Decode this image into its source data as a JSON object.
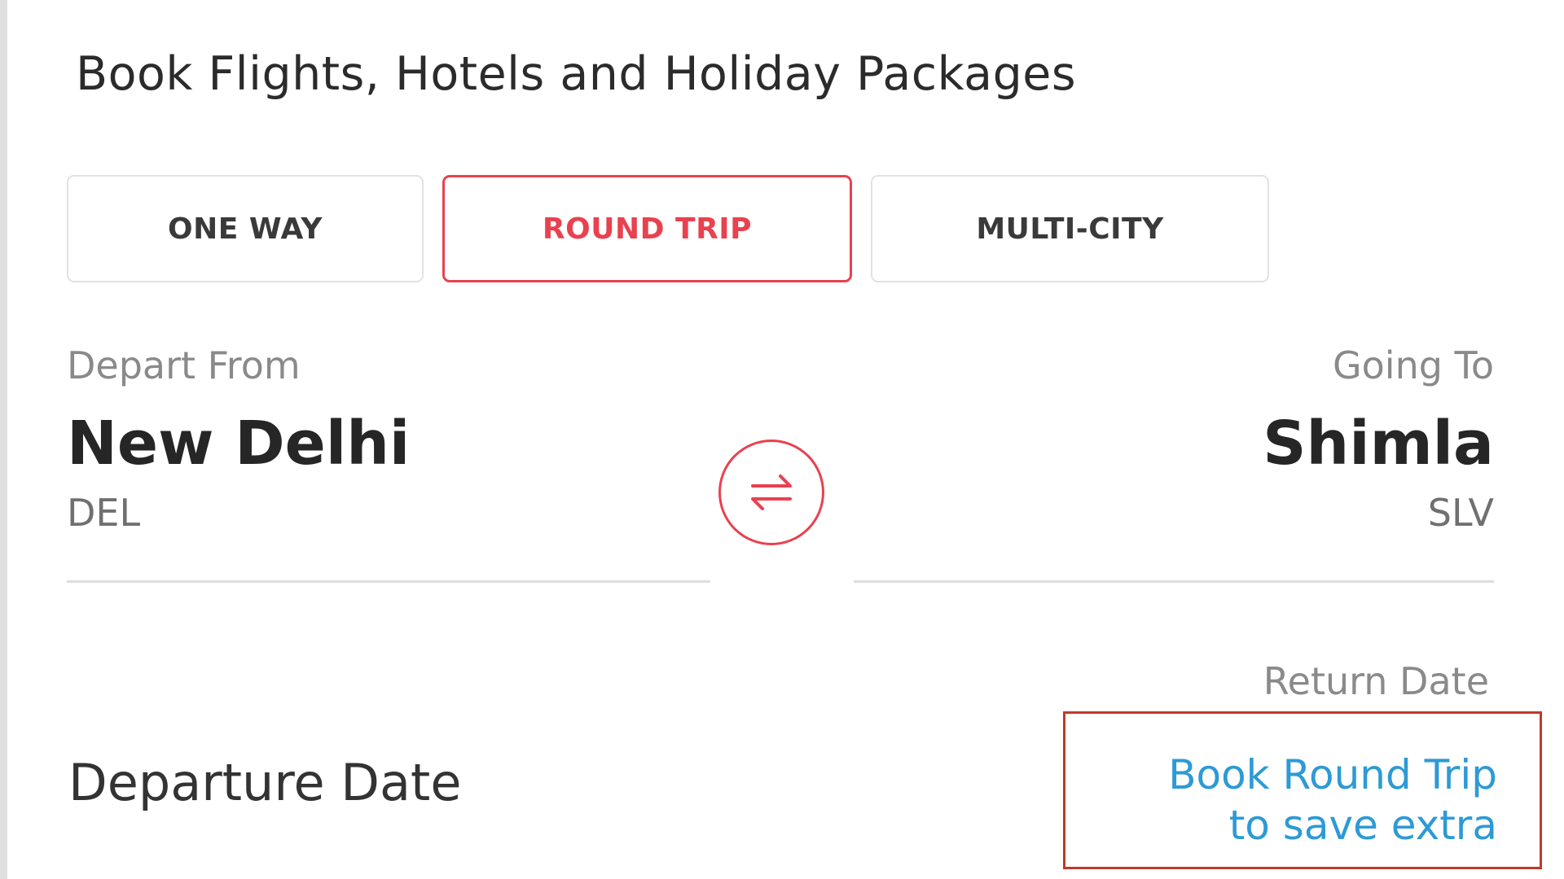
{
  "header": {
    "title": "Book Flights, Hotels and Holiday Packages"
  },
  "trip_tabs": [
    {
      "label": "ONE WAY",
      "active": false
    },
    {
      "label": "ROUND TRIP",
      "active": true
    },
    {
      "label": "MULTI-CITY",
      "active": false
    }
  ],
  "route": {
    "from": {
      "label": "Depart From",
      "city": "New Delhi",
      "code": "DEL"
    },
    "to": {
      "label": "Going To",
      "city": "Shimla",
      "code": "SLV"
    },
    "swap_icon": "swap-arrows-icon"
  },
  "dates": {
    "departure_label": "Departure Date",
    "return_label": "Return Date",
    "return_promo_line1": "Book Round Trip",
    "return_promo_line2": "to save extra"
  },
  "colors": {
    "accent": "#e9414f",
    "link": "#2d9ad6",
    "highlight_border": "#c0392b"
  }
}
